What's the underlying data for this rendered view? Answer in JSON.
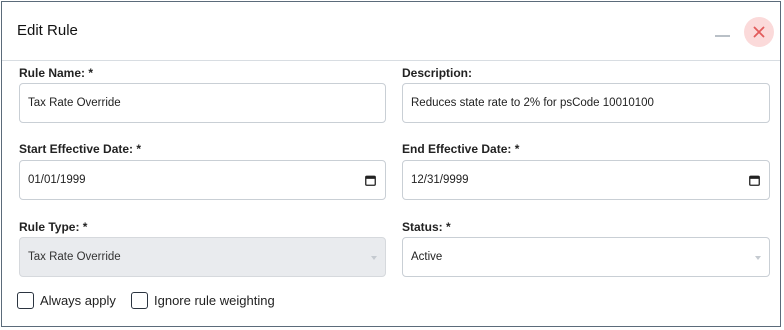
{
  "dialog": {
    "title": "Edit Rule",
    "minimize_icon": "minimize-icon",
    "close_icon": "close-icon",
    "close_bg_color": "#fbdada",
    "close_x_color": "#e25b5b"
  },
  "form": {
    "rule_name": {
      "label": "Rule Name: *",
      "value": "Tax Rate Override"
    },
    "description": {
      "label": "Description:",
      "value": "Reduces state rate to 2% for psCode 10010100"
    },
    "start_date": {
      "label": "Start Effective Date: *",
      "value": "01/01/1999",
      "icon": "calendar-icon"
    },
    "end_date": {
      "label": "End Effective Date: *",
      "value": "12/31/9999",
      "icon": "calendar-icon"
    },
    "rule_type": {
      "label": "Rule Type: *",
      "value": "Tax Rate Override",
      "disabled": true,
      "icon": "chevron-down-icon"
    },
    "status": {
      "label": "Status: *",
      "value": "Active",
      "icon": "chevron-down-icon"
    },
    "always_apply": {
      "label": "Always apply",
      "checked": false
    },
    "ignore_weighting": {
      "label": "Ignore rule weighting",
      "checked": false
    }
  }
}
